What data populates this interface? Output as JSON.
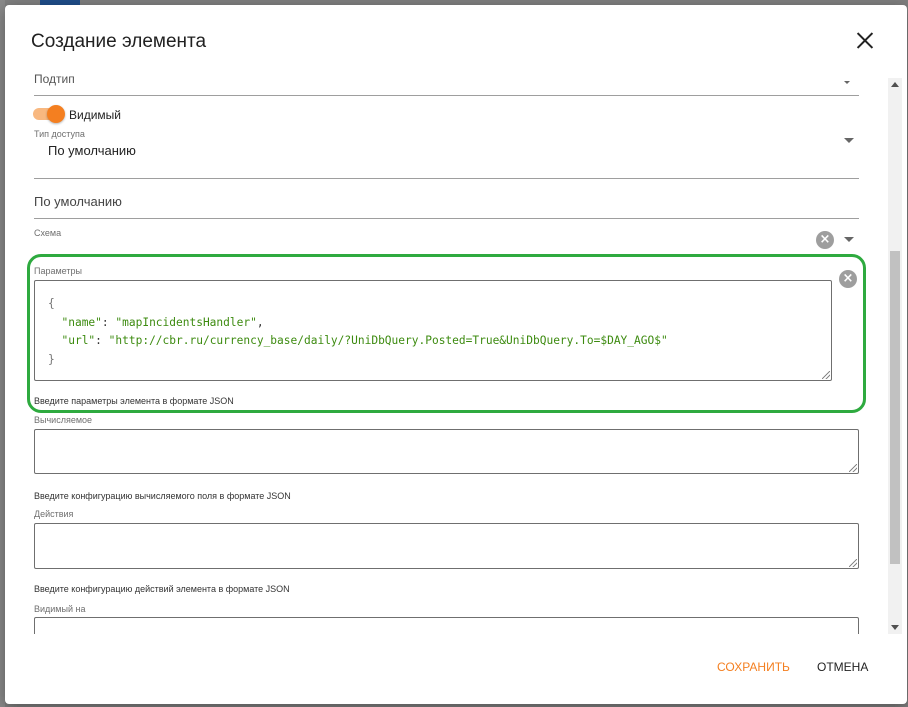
{
  "dialog": {
    "title": "Создание элемента",
    "save_label": "СОХРАНИТЬ",
    "cancel_label": "ОТМЕНА"
  },
  "form": {
    "subtype_label": "Подтип",
    "visible_label": "Видимый",
    "visible_on": true,
    "access_type_label": "Тип доступа",
    "access_type_value": "По умолчанию",
    "default_value": "По умолчанию",
    "schema_label": "Схема",
    "params_label": "Параметры",
    "params_json": {
      "open": "{",
      "name_key": "\"name\"",
      "name_value": "\"mapIncidentsHandler\"",
      "url_key": "\"url\"",
      "url_value": "\"http://cbr.ru/currency_base/daily/?UniDbQuery.Posted=True&UniDbQuery.To=$DAY_AGO$\"",
      "close": "}"
    },
    "params_helper": "Введите параметры элемента в формате JSON",
    "computed_label": "Вычисляемое",
    "computed_helper": "Введите конфигурацию вычисляемого поля в формате JSON",
    "actions_label": "Действия",
    "actions_helper": "Введите конфигурацию действий элемента в формате JSON",
    "visible_on_label": "Видимый на"
  },
  "colors": {
    "accent": "#f47f20",
    "highlight": "#2eaa3f",
    "json_string": "#3d8b10"
  },
  "icons": {
    "close": "close-icon",
    "clear": "clear-circle-icon",
    "dropdown": "chevron-down-icon"
  }
}
